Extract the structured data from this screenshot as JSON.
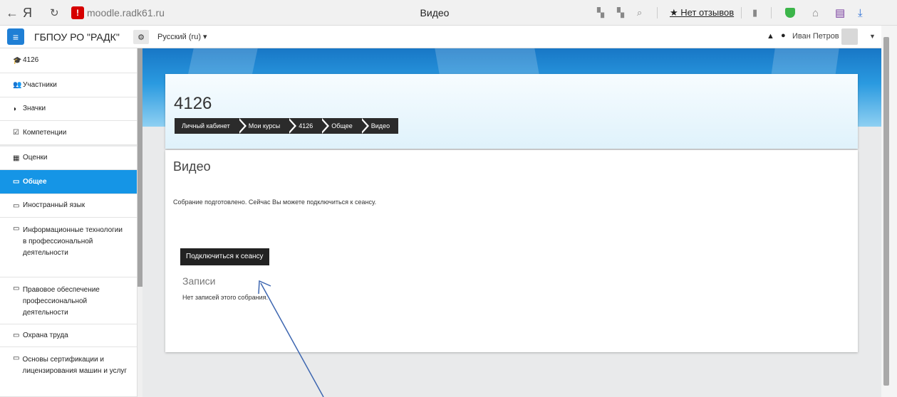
{
  "browser": {
    "back_icon": "←",
    "brand": "Я",
    "reload_icon": "↻",
    "address": "moodle.radk61.ru",
    "tab_title": "Видео",
    "review_label": "★ Нет отзывов"
  },
  "navbar": {
    "menu_icon": "≡",
    "site_name": "ГБПОУ РО \"РАДК\"",
    "lang_icon": "⚙",
    "language": "Русский (ru) ▾",
    "user_name": "Иван Петров",
    "caret": "▼"
  },
  "sidebar": {
    "items": [
      {
        "icon": "🎓",
        "label": "4126"
      },
      {
        "icon": "👥",
        "label": "Участники"
      },
      {
        "icon": "◗",
        "label": "Значки"
      },
      {
        "icon": "☑",
        "label": "Компетенции"
      },
      {
        "icon": "▦",
        "label": "Оценки"
      },
      {
        "icon": "▭",
        "label": "Общее"
      },
      {
        "icon": "▭",
        "label": "Иностранный язык"
      },
      {
        "icon": "▭",
        "label": "Информационные технологии в профессиональной деятельности"
      },
      {
        "icon": "▭",
        "label": "Правовое обеспечение профессиональной деятельности"
      },
      {
        "icon": "▭",
        "label": "Охрана труда"
      },
      {
        "icon": "▭",
        "label": "Основы сертификации и лицензирования машин и услуг"
      }
    ]
  },
  "page": {
    "course_title": "4126",
    "breadcrumb": [
      "Личный кабинет",
      "Мои курсы",
      "4126",
      "Общее",
      "Видео"
    ],
    "content_title": "Видео",
    "message": "Собрание подготовлено. Сейчас Вы можете подключиться к сеансу.",
    "join_button": "Подключиться к сеансу",
    "recordings_title": "Записи",
    "recordings_empty": "Нет записей этого собрания."
  },
  "colors": {
    "accent": "#1595e6",
    "menu_button": "#1f7fd5",
    "breadcrumb_bg": "#2b2b2b",
    "annotation_arrow": "#3d66b0"
  }
}
